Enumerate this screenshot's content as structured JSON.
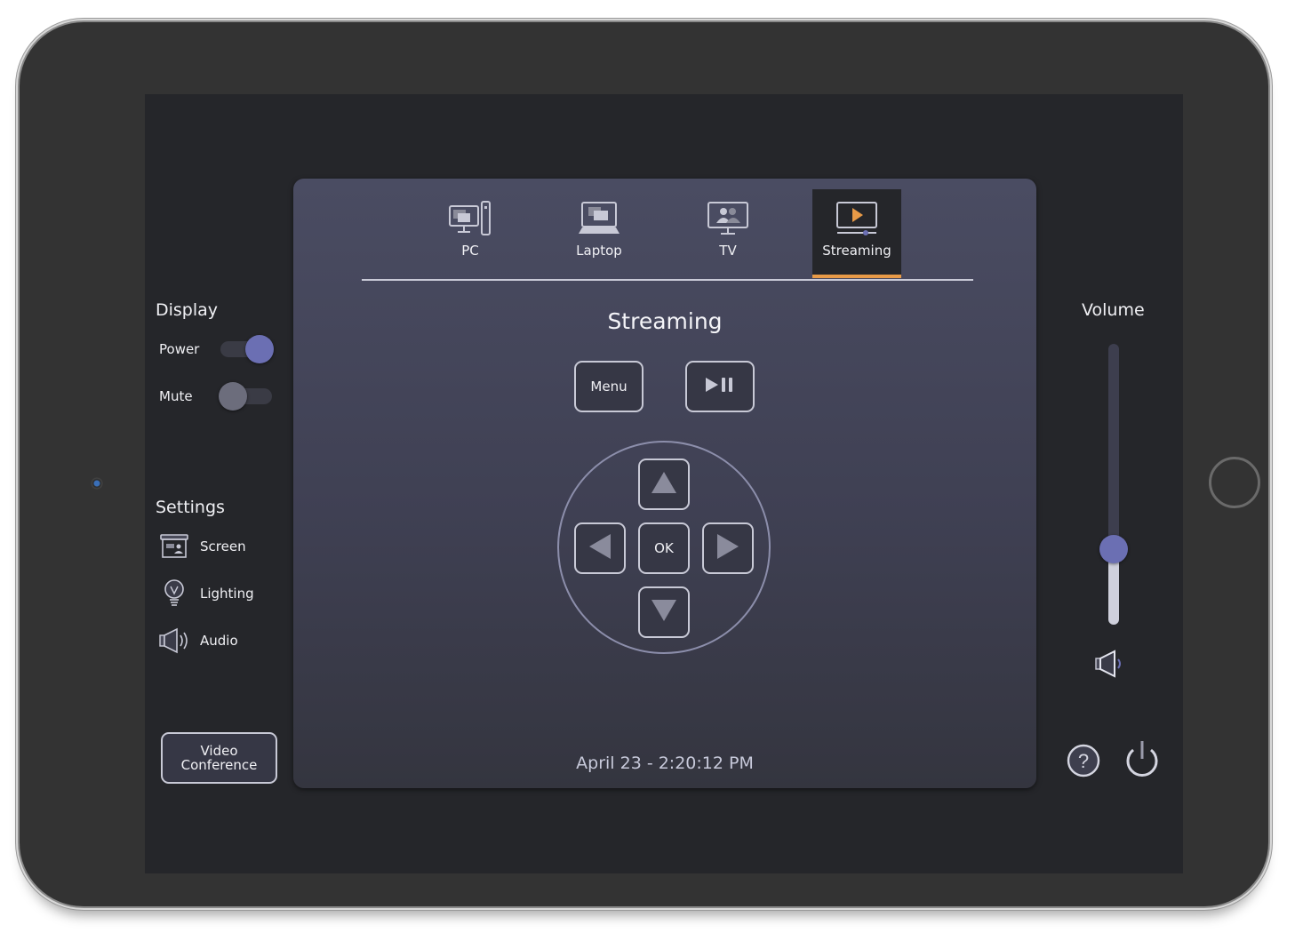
{
  "display": {
    "title": "Display",
    "power": {
      "label": "Power",
      "on": true
    },
    "mute": {
      "label": "Mute",
      "on": false
    }
  },
  "settings": {
    "title": "Settings",
    "items": [
      {
        "label": "Screen",
        "icon": "projector-screen-icon"
      },
      {
        "label": "Lighting",
        "icon": "lightbulb-icon"
      },
      {
        "label": "Audio",
        "icon": "speaker-icon"
      }
    ]
  },
  "video_conference": {
    "line1": "Video",
    "line2": "Conference"
  },
  "sources": {
    "tabs": [
      {
        "label": "PC",
        "icon": "pc-icon",
        "active": false
      },
      {
        "label": "Laptop",
        "icon": "laptop-icon",
        "active": false
      },
      {
        "label": "TV",
        "icon": "tv-icon",
        "active": false
      },
      {
        "label": "Streaming",
        "icon": "streaming-icon",
        "active": true
      }
    ],
    "accent_color": "#e89a47"
  },
  "main": {
    "title": "Streaming",
    "menu_label": "Menu",
    "play_pause_icon": "play-pause-icon",
    "ok_label": "OK",
    "datetime": "April 23 - 2:20:12 PM"
  },
  "volume": {
    "title": "Volume",
    "level_percent": 27,
    "knob_color": "#6b6fb3"
  }
}
